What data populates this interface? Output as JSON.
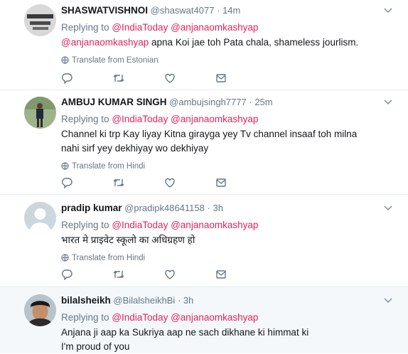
{
  "tweets": [
    {
      "name": "SHASWATVISHNOI",
      "handle": "@shaswat4077",
      "dot": "·",
      "time": "14m",
      "replying": "Replying to",
      "mention1": "@IndiaToday",
      "mention2": "@anjanaomkashyap",
      "text_mention": "@anjanaomkashyap",
      "text": " apna Koi jae toh Pata chala, shameless jourlism.",
      "translate": "Translate from Estonian"
    },
    {
      "name": "AMBUJ KUMAR SINGH",
      "handle": "@ambujsingh7777",
      "dot": "·",
      "time": "25m",
      "replying": "Replying to",
      "mention1": "@IndiaToday",
      "mention2": "@anjanaomkashyap",
      "text": "Channel ki trp Kay liyay Kitna girayga yey Tv channel insaaf toh milna nahi sirf yey dekhiyay wo dekhiyay",
      "translate": "Translate from Hindi"
    },
    {
      "name": "pradip kumar",
      "handle": "@pradipk48641158",
      "dot": "·",
      "time": "3h",
      "replying": "Replying to",
      "mention1": "@IndiaToday",
      "mention2": "@anjanaomkashyap",
      "text": "भारत मे प्राइवेट स्कूलो का अधिग्रहण हो",
      "translate": "Translate from Hindi"
    },
    {
      "name": "bilalsheikh",
      "handle": "@BilalsheikhBi",
      "dot": "·",
      "time": "3h",
      "replying": "Replying to",
      "mention1": "@IndiaToday",
      "mention2": "@anjanaomkashyap",
      "text_line1": "Anjana ji aap ka Sukriya aap ne sach dikhane ki himmat ki",
      "text_line2": "I'm proud of you"
    }
  ],
  "colors": {
    "mention": "#e0245e",
    "muted": "#657786",
    "highlight_bg": "#f5f8fa",
    "divider": "#e6ecf0"
  },
  "icons": [
    "chevron-down-icon",
    "globe-icon",
    "reply-icon",
    "retweet-icon",
    "like-icon",
    "message-icon"
  ]
}
